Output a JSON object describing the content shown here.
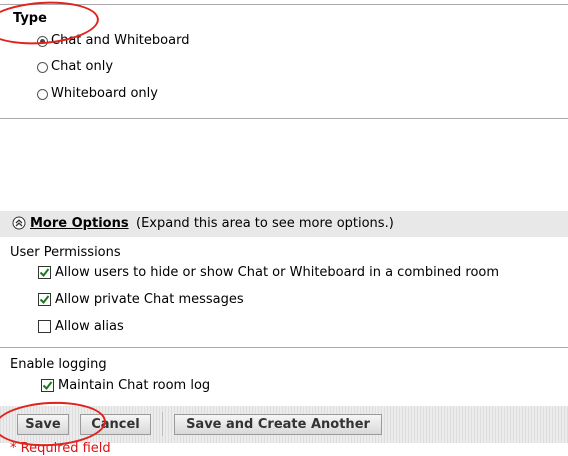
{
  "type_section": {
    "heading": "Type",
    "options": [
      {
        "label": "Chat and Whiteboard",
        "checked": true
      },
      {
        "label": "Chat only",
        "checked": false
      },
      {
        "label": "Whiteboard only",
        "checked": false
      }
    ]
  },
  "more_options": {
    "link_label": "More Options",
    "hint": "(Expand this area to see more options.)"
  },
  "permissions": {
    "heading": "User Permissions",
    "items": [
      {
        "label": "Allow users to hide or show Chat or Whiteboard in a combined room",
        "checked": true
      },
      {
        "label": "Allow private Chat messages",
        "checked": true
      },
      {
        "label": "Allow alias",
        "checked": false
      }
    ]
  },
  "logging": {
    "heading": "Enable logging",
    "items": [
      {
        "label": "Maintain Chat room log",
        "checked": true
      }
    ]
  },
  "buttons": {
    "save": "Save",
    "cancel": "Cancel",
    "save_another": "Save and Create Another"
  },
  "required_note": "* Required field",
  "colors": {
    "annotation_red": "#e0231d",
    "required_red": "#dd1111",
    "link": "#000000"
  }
}
